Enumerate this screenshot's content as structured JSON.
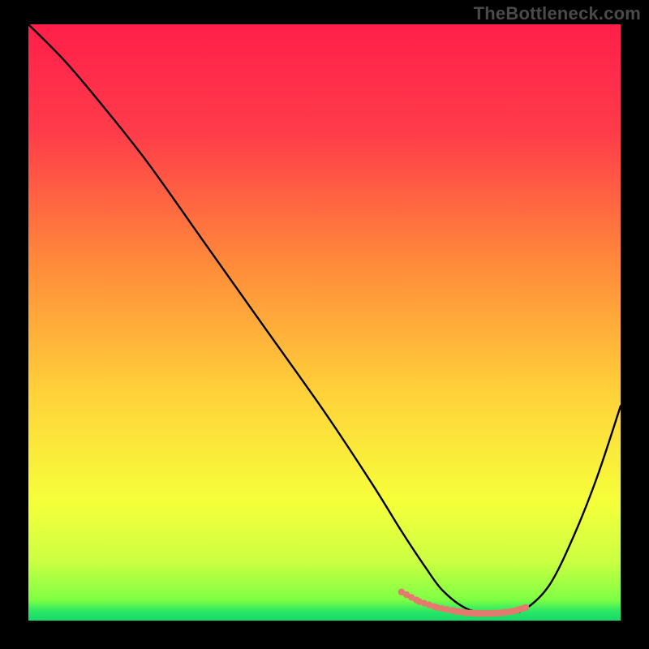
{
  "watermark": "TheBottleneck.com",
  "chart_data": {
    "type": "line",
    "title": "",
    "xlabel": "",
    "ylabel": "",
    "xlim": [
      0,
      100
    ],
    "ylim": [
      0,
      100
    ],
    "curve": {
      "name": "bottleneck-curve",
      "x": [
        0,
        6,
        12,
        20,
        30,
        40,
        50,
        58,
        63,
        67,
        70,
        74,
        78,
        81,
        84,
        88,
        92,
        96,
        100
      ],
      "y": [
        100,
        94,
        87,
        77,
        63,
        49,
        35,
        23,
        15,
        9,
        5,
        2,
        1.2,
        1.2,
        2,
        6,
        14,
        24,
        36
      ]
    },
    "dotted_segment": {
      "name": "optimal-range",
      "x": [
        63,
        66,
        69,
        72,
        74,
        76,
        78,
        80,
        82,
        84
      ],
      "y": [
        4.8,
        3.2,
        2.2,
        1.6,
        1.3,
        1.2,
        1.2,
        1.3,
        1.6,
        2.2
      ]
    },
    "gradient_stops": [
      {
        "offset": 0.0,
        "color": "#ff1f49"
      },
      {
        "offset": 0.18,
        "color": "#ff3b4a"
      },
      {
        "offset": 0.4,
        "color": "#ff8a3a"
      },
      {
        "offset": 0.62,
        "color": "#ffd23a"
      },
      {
        "offset": 0.8,
        "color": "#f6ff3a"
      },
      {
        "offset": 0.9,
        "color": "#ccff42"
      },
      {
        "offset": 0.965,
        "color": "#7fff44"
      },
      {
        "offset": 0.985,
        "color": "#28e765"
      },
      {
        "offset": 1.0,
        "color": "#17d96a"
      }
    ]
  }
}
